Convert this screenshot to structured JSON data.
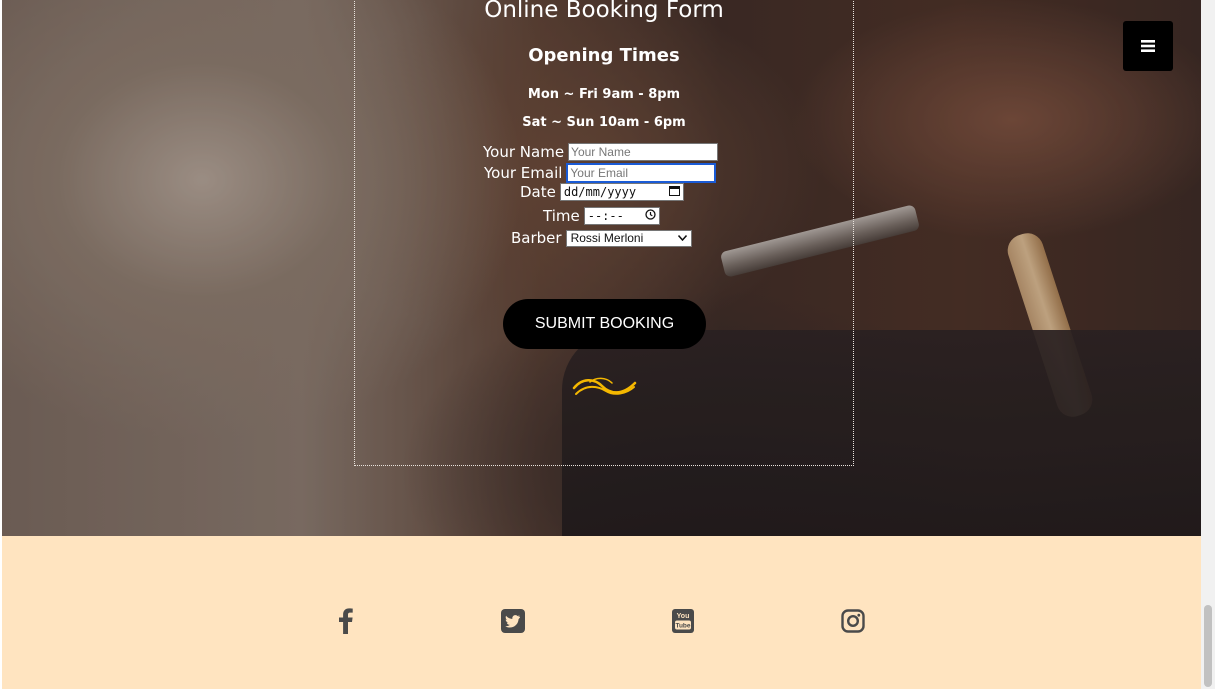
{
  "menu": {
    "icon": "hamburger-menu-icon",
    "label": "≡"
  },
  "booking": {
    "title": "Online Booking Form",
    "hours_title": "Opening Times",
    "hours": [
      "Mon ~ Fri 9am - 8pm",
      "Sat ~ Sun 10am - 6pm"
    ],
    "fields": {
      "name": {
        "label": "Your Name",
        "placeholder": "Your Name"
      },
      "email": {
        "label": "Your Email",
        "placeholder": "Your Email"
      },
      "date": {
        "label": "Date",
        "value": "dd/mm/yyyy"
      },
      "time": {
        "label": "Time",
        "value": "--:--"
      },
      "barber": {
        "label": "Barber",
        "selected": "Rossi Merloni"
      }
    },
    "submit_label": "SUBMIT BOOKING",
    "flourish_color": "#f5b800"
  },
  "footer": {
    "background": "#ffe4c0",
    "social": [
      {
        "name": "facebook-icon",
        "glyph": "f"
      },
      {
        "name": "twitter-icon",
        "glyph": "t"
      },
      {
        "name": "youtube-icon",
        "glyph": "You Tube"
      },
      {
        "name": "instagram-icon",
        "glyph": "ig"
      }
    ]
  }
}
